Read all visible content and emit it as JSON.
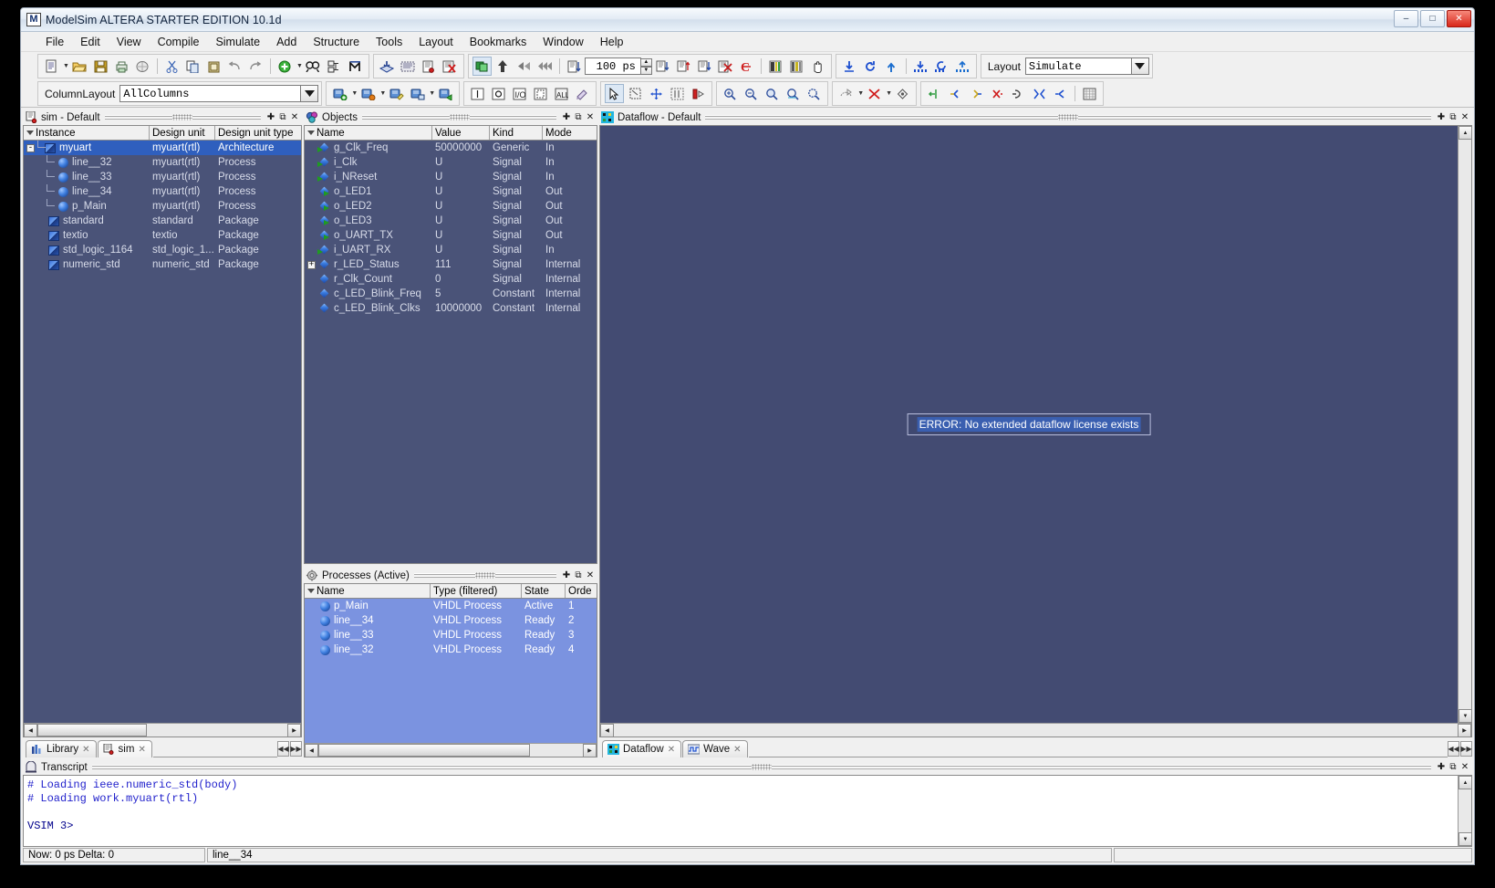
{
  "window": {
    "title": "ModelSim ALTERA STARTER EDITION 10.1d",
    "app_icon": "M",
    "minimize": "–",
    "maximize": "□",
    "close": "✕"
  },
  "menubar": {
    "items": [
      "File",
      "Edit",
      "View",
      "Compile",
      "Simulate",
      "Add",
      "Structure",
      "Tools",
      "Layout",
      "Bookmarks",
      "Window",
      "Help"
    ]
  },
  "toolbar": {
    "column_layout_label": "ColumnLayout",
    "column_layout_value": "AllColumns",
    "run_length_value": "100 ps",
    "layout_label": "Layout",
    "layout_value": "Simulate",
    "row1_icons": [
      "new-file-icon",
      "open-folder-icon",
      "save-icon",
      "print-icon",
      "print-preview-icon",
      "cut-icon",
      "copy-icon",
      "paste-icon",
      "undo-icon",
      "redo-icon",
      "add-wave-icon",
      "find-icon",
      "expand-tree-icon",
      "modelsim-icon",
      "compile-icon",
      "compile-all-icon",
      "simulate-icon",
      "end-simulation-icon",
      "restart-icon",
      "run-icon",
      "continue-run-icon",
      "run-all-icon",
      "break-icon",
      "step-icon",
      "step-over-icon",
      "step-out-icon",
      "stop-icon",
      "error-icon",
      "wave-compare-icon",
      "wave-compare-all-icon",
      "hand-icon",
      "collapse-icon",
      "reload-icon",
      "up-icon",
      "down-all-icon",
      "reload-all-icon",
      "up-all-icon"
    ],
    "row2_icons": [
      "new-object-icon",
      "delete-object-icon",
      "edit-object-icon",
      "save-object-icon",
      "refresh-object-icon",
      "signal-icon",
      "circle-icon",
      "io-icon",
      "region-icon",
      "all-icon",
      "colorize-icon",
      "select-mode-icon",
      "zoom-select-icon",
      "pan-icon",
      "split-icon",
      "flow-icon",
      "zoom-in-icon",
      "zoom-out-icon",
      "zoom-full-icon",
      "zoom-fit-icon",
      "zoom-last-icon",
      "trace-set-icon",
      "trace-clear-icon",
      "trace-event-icon",
      "expand-net-icon",
      "expand-net-in-icon",
      "expand-net-out-icon",
      "delete-net-icon",
      "erase-highlight-icon",
      "collapse-net-icon",
      "show-wave-icon",
      "grid-icon"
    ]
  },
  "sim_panel": {
    "title": "sim - Default",
    "icon": "sim-icon",
    "columns": [
      "Instance",
      "Design unit",
      "Design unit type"
    ],
    "rows": [
      {
        "instance": "myuart",
        "unit": "myuart(rtl)",
        "type": "Architecture",
        "icon": "module-icon",
        "depth": 0,
        "expander": "-",
        "selected": true
      },
      {
        "instance": "line__32",
        "unit": "myuart(rtl)",
        "type": "Process",
        "icon": "process-icon",
        "depth": 1,
        "selected": false
      },
      {
        "instance": "line__33",
        "unit": "myuart(rtl)",
        "type": "Process",
        "icon": "process-icon",
        "depth": 1,
        "selected": false
      },
      {
        "instance": "line__34",
        "unit": "myuart(rtl)",
        "type": "Process",
        "icon": "process-icon",
        "depth": 1,
        "selected": false
      },
      {
        "instance": "p_Main",
        "unit": "myuart(rtl)",
        "type": "Process",
        "icon": "process-icon",
        "depth": 1,
        "last": true,
        "selected": false
      },
      {
        "instance": "standard",
        "unit": "standard",
        "type": "Package",
        "icon": "module-icon",
        "depth": 0,
        "selected": false
      },
      {
        "instance": "textio",
        "unit": "textio",
        "type": "Package",
        "icon": "module-icon",
        "depth": 0,
        "selected": false
      },
      {
        "instance": "std_logic_1164",
        "unit": "std_logic_1...",
        "type": "Package",
        "icon": "module-icon",
        "depth": 0,
        "selected": false
      },
      {
        "instance": "numeric_std",
        "unit": "numeric_std",
        "type": "Package",
        "icon": "module-icon",
        "depth": 0,
        "selected": false
      }
    ]
  },
  "objects_panel": {
    "title": "Objects",
    "icon": "objects-icon",
    "columns": [
      "Name",
      "Value",
      "Kind",
      "Mode"
    ],
    "rows": [
      {
        "name": "g_Clk_Freq",
        "value": "50000000",
        "kind": "Generic",
        "mode": "In",
        "dir": "in"
      },
      {
        "name": "i_Clk",
        "value": "U",
        "kind": "Signal",
        "mode": "In",
        "dir": "in"
      },
      {
        "name": "i_NReset",
        "value": "U",
        "kind": "Signal",
        "mode": "In",
        "dir": "in"
      },
      {
        "name": "o_LED1",
        "value": "U",
        "kind": "Signal",
        "mode": "Out",
        "dir": "out"
      },
      {
        "name": "o_LED2",
        "value": "U",
        "kind": "Signal",
        "mode": "Out",
        "dir": "out"
      },
      {
        "name": "o_LED3",
        "value": "U",
        "kind": "Signal",
        "mode": "Out",
        "dir": "out"
      },
      {
        "name": "o_UART_TX",
        "value": "U",
        "kind": "Signal",
        "mode": "Out",
        "dir": "out"
      },
      {
        "name": "i_UART_RX",
        "value": "U",
        "kind": "Signal",
        "mode": "In",
        "dir": "in"
      },
      {
        "name": "r_LED_Status",
        "value": "111",
        "kind": "Signal",
        "mode": "Internal",
        "dir": "none",
        "expander": "+"
      },
      {
        "name": "r_Clk_Count",
        "value": "0",
        "kind": "Signal",
        "mode": "Internal",
        "dir": "none"
      },
      {
        "name": "c_LED_Blink_Freq",
        "value": "5",
        "kind": "Constant",
        "mode": "Internal",
        "dir": "none"
      },
      {
        "name": "c_LED_Blink_Clks",
        "value": "10000000",
        "kind": "Constant",
        "mode": "Internal",
        "dir": "none"
      }
    ]
  },
  "processes_panel": {
    "title": "Processes (Active)",
    "icon": "processes-icon",
    "columns": [
      "Name",
      "Type (filtered)",
      "State",
      "Orde"
    ],
    "rows": [
      {
        "name": "p_Main",
        "type": "VHDL Process",
        "state": "Active",
        "order": "1"
      },
      {
        "name": "line__34",
        "type": "VHDL Process",
        "state": "Ready",
        "order": "2"
      },
      {
        "name": "line__33",
        "type": "VHDL Process",
        "state": "Ready",
        "order": "3"
      },
      {
        "name": "line__32",
        "type": "VHDL Process",
        "state": "Ready",
        "order": "4"
      }
    ]
  },
  "dataflow_panel": {
    "title": "Dataflow - Default",
    "icon": "dataflow-icon",
    "error_message": "ERROR: No extended dataflow license exists"
  },
  "window_tabs": {
    "left": [
      {
        "label": "Library",
        "icon": "library-icon",
        "active": false
      },
      {
        "label": "sim",
        "icon": "sim-icon",
        "active": true
      }
    ],
    "right": [
      {
        "label": "Dataflow",
        "icon": "dataflow-icon",
        "active": true
      },
      {
        "label": "Wave",
        "icon": "wave-icon",
        "active": false
      }
    ]
  },
  "transcript": {
    "title": "Transcript",
    "icon": "transcript-icon",
    "lines": [
      "# Loading ieee.numeric_std(body)",
      "# Loading work.myuart(rtl)",
      "",
      "VSIM 3>"
    ]
  },
  "statusbar": {
    "left": "Now: 0 ps  Delta: 0",
    "middle": "line__34",
    "right": ""
  },
  "colors": {
    "pane_background": "#4a5378",
    "dataflow_background": "#434b72",
    "selection": "#2f5fbe",
    "process_selection": "#7b93e0",
    "chrome": "#f0f0f0",
    "transcript_text": "#2222cc"
  }
}
